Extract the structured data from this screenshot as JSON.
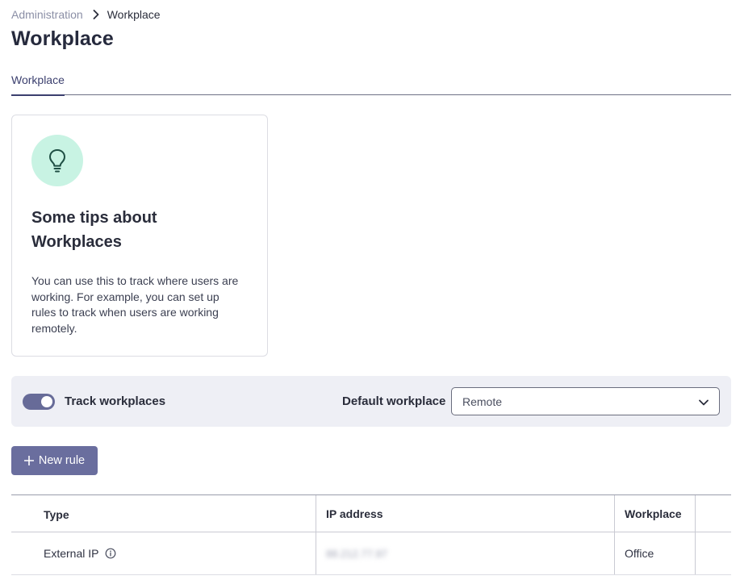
{
  "breadcrumb": {
    "parent": "Administration",
    "current": "Workplace"
  },
  "page": {
    "title": "Workplace"
  },
  "tabs": [
    {
      "label": "Workplace",
      "active": true
    }
  ],
  "tips": {
    "title": "Some tips about Workplaces",
    "body": "You can use this to track where users are working. For example, you can set up rules to track when users are working remotely.",
    "icon": "lightbulb-icon"
  },
  "settings": {
    "track_label": "Track workplaces",
    "track_enabled": true,
    "default_label": "Default workplace",
    "default_value": "Remote"
  },
  "actions": {
    "new_rule_label": "New rule"
  },
  "table": {
    "columns": [
      "Type",
      "IP address",
      "Workplace"
    ],
    "rows": [
      {
        "type": "External IP",
        "ip": "88.212.77.97",
        "workplace": "Office"
      }
    ]
  },
  "colors": {
    "accent": "#6a6e9e",
    "tip_icon_bg": "#c8f3e3",
    "settings_bg": "#eeeff5"
  }
}
